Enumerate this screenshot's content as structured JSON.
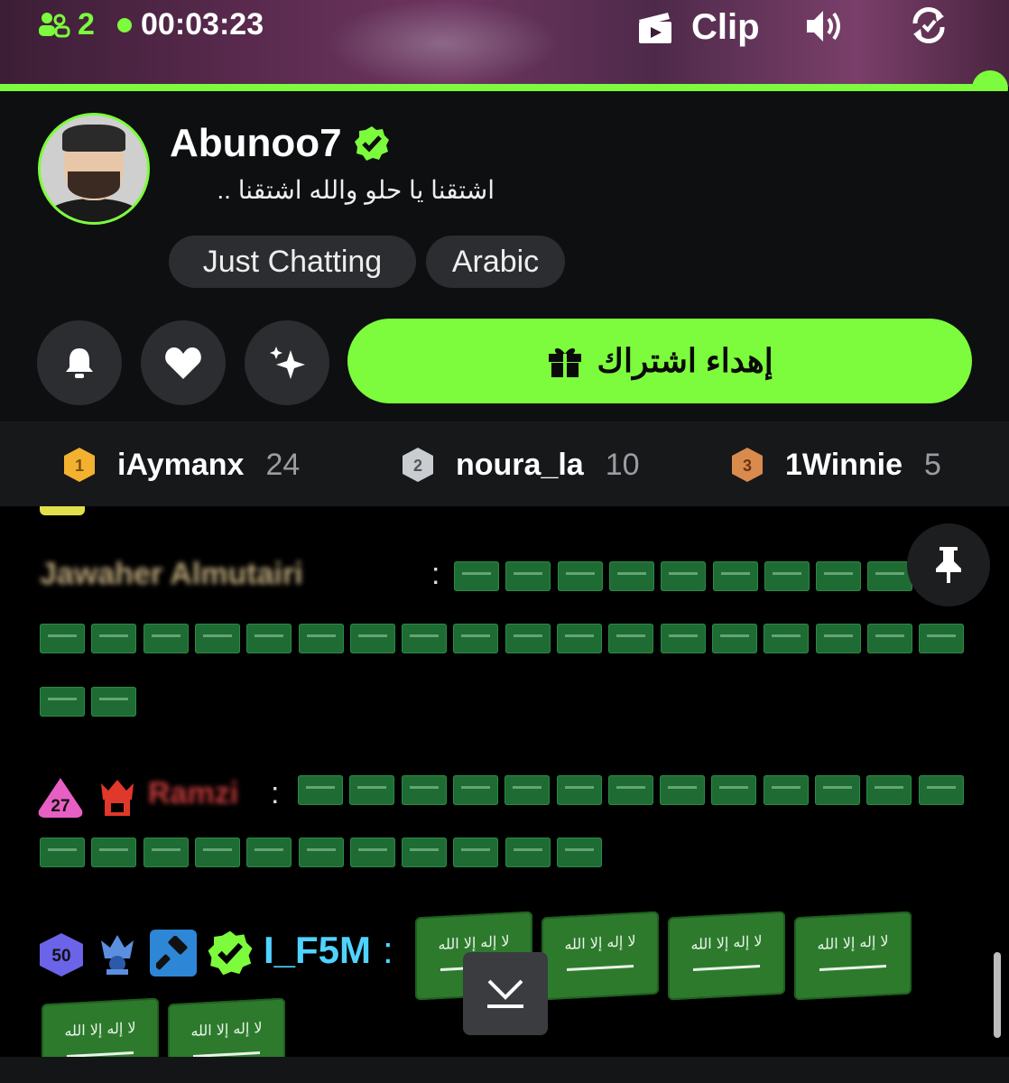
{
  "player": {
    "viewer_count": "2",
    "elapsed_time": "00:03:23",
    "clip_label": "Clip",
    "progress_fraction": 0.98
  },
  "channel": {
    "name": "Abunoo7",
    "verified": true,
    "stream_title": "اشتقنا يا حلو والله اشتقنا ..",
    "tags": [
      "Just Chatting",
      "Arabic"
    ],
    "gift_button_label": "إهداء اشتراك"
  },
  "leaderboard": [
    {
      "rank": "1",
      "user": "iAymanx",
      "count": "24",
      "color": "#f2b230"
    },
    {
      "rank": "2",
      "user": "noura_la",
      "count": "10",
      "color": "#c9ccd1"
    },
    {
      "rank": "3",
      "user": "1Winnie",
      "count": "5",
      "color": "#d98b4e"
    }
  ],
  "chat": {
    "messages": [
      {
        "sender": "blurred",
        "badges": [],
        "flags_small": 29
      },
      {
        "sender": "blurred",
        "badges": [
          "27"
        ],
        "flags_small": 24
      },
      {
        "sender": "I_F5M",
        "badges": [
          "50",
          "king",
          "moderator",
          "verified"
        ],
        "flags_big": 6
      }
    ],
    "badge_27_label": "27",
    "badge_50_label": "50",
    "user_color": "#4fd3ff",
    "colon": ":"
  },
  "colors": {
    "accent": "#7CFC3C",
    "panel": "#0e0f10",
    "chip": "#2b2d30"
  }
}
